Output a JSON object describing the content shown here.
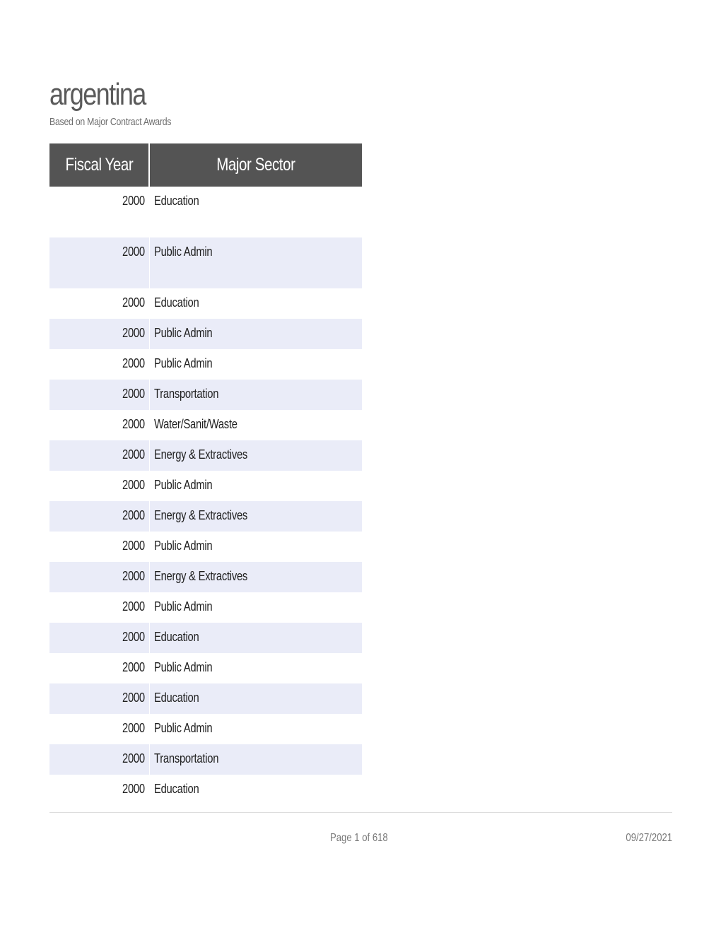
{
  "header": {
    "title": "argentina",
    "subtitle": "Based on Major Contract Awards"
  },
  "table": {
    "columns": [
      "Fiscal Year",
      "Major Sector"
    ],
    "rows": [
      {
        "year": "2000",
        "sector": "Education"
      },
      {
        "year": "2000",
        "sector": "Public Admin"
      },
      {
        "year": "2000",
        "sector": "Education"
      },
      {
        "year": "2000",
        "sector": "Public Admin"
      },
      {
        "year": "2000",
        "sector": "Public Admin"
      },
      {
        "year": "2000",
        "sector": "Transportation"
      },
      {
        "year": "2000",
        "sector": "Water/Sanit/Waste"
      },
      {
        "year": "2000",
        "sector": "Energy & Extractives"
      },
      {
        "year": "2000",
        "sector": "Public Admin"
      },
      {
        "year": "2000",
        "sector": "Energy & Extractives"
      },
      {
        "year": "2000",
        "sector": "Public Admin"
      },
      {
        "year": "2000",
        "sector": "Energy & Extractives"
      },
      {
        "year": "2000",
        "sector": "Public Admin"
      },
      {
        "year": "2000",
        "sector": "Education"
      },
      {
        "year": "2000",
        "sector": "Public Admin"
      },
      {
        "year": "2000",
        "sector": "Education"
      },
      {
        "year": "2000",
        "sector": "Public Admin"
      },
      {
        "year": "2000",
        "sector": "Transportation"
      },
      {
        "year": "2000",
        "sector": "Education"
      }
    ]
  },
  "footer": {
    "page": "Page 1 of 618",
    "date": "09/27/2021"
  }
}
